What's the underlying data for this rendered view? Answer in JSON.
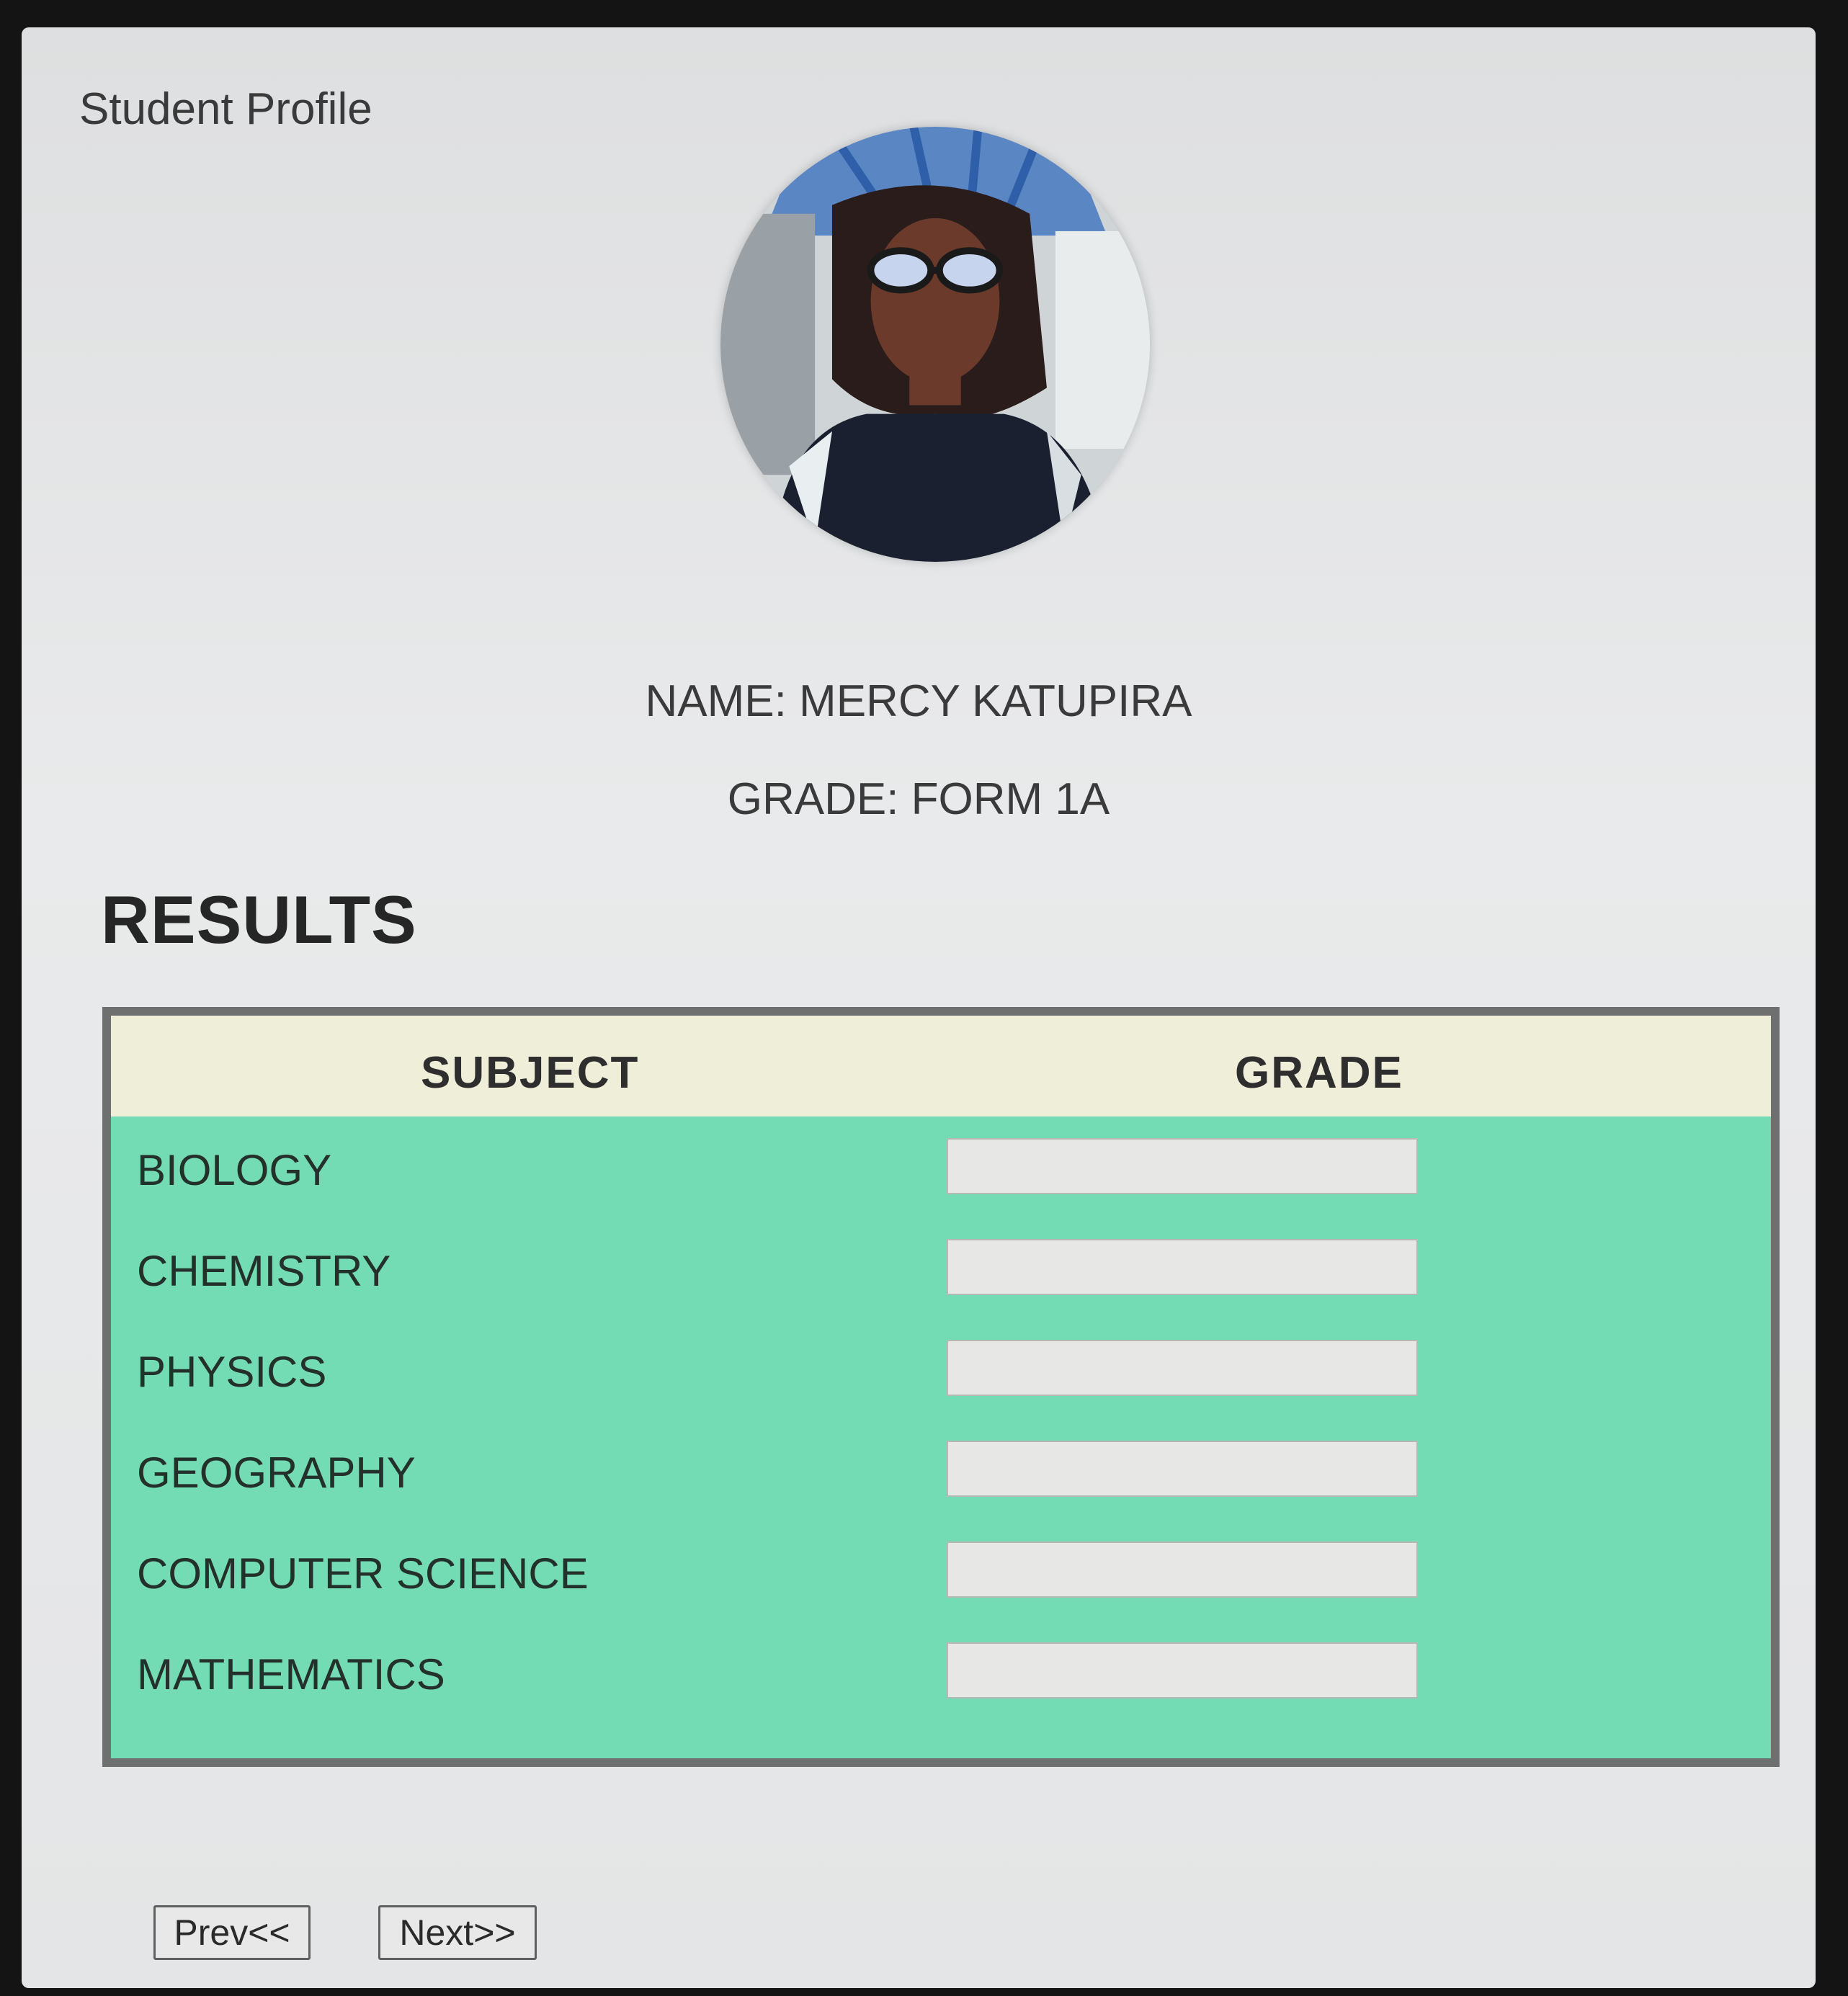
{
  "window": {
    "title": "Student Profile"
  },
  "profile": {
    "name_line": "NAME: MERCY KATUPIRA",
    "grade_line": "GRADE: FORM 1A"
  },
  "results": {
    "heading": "RESULTS",
    "headers": {
      "subject": "SUBJECT",
      "grade": "GRADE"
    },
    "rows": [
      {
        "subject": "BIOLOGY",
        "grade": ""
      },
      {
        "subject": "CHEMISTRY",
        "grade": ""
      },
      {
        "subject": "PHYSICS",
        "grade": ""
      },
      {
        "subject": "GEOGRAPHY",
        "grade": ""
      },
      {
        "subject": "COMPUTER SCIENCE",
        "grade": ""
      },
      {
        "subject": "MATHEMATICS",
        "grade": ""
      }
    ]
  },
  "nav": {
    "prev_label": "Prev<<",
    "next_label": "Next>>"
  },
  "colors": {
    "table_body": "#74dcb4",
    "table_header": "#eeeed9",
    "table_border": "#6d706e",
    "page_background": "#e6e7e8"
  }
}
